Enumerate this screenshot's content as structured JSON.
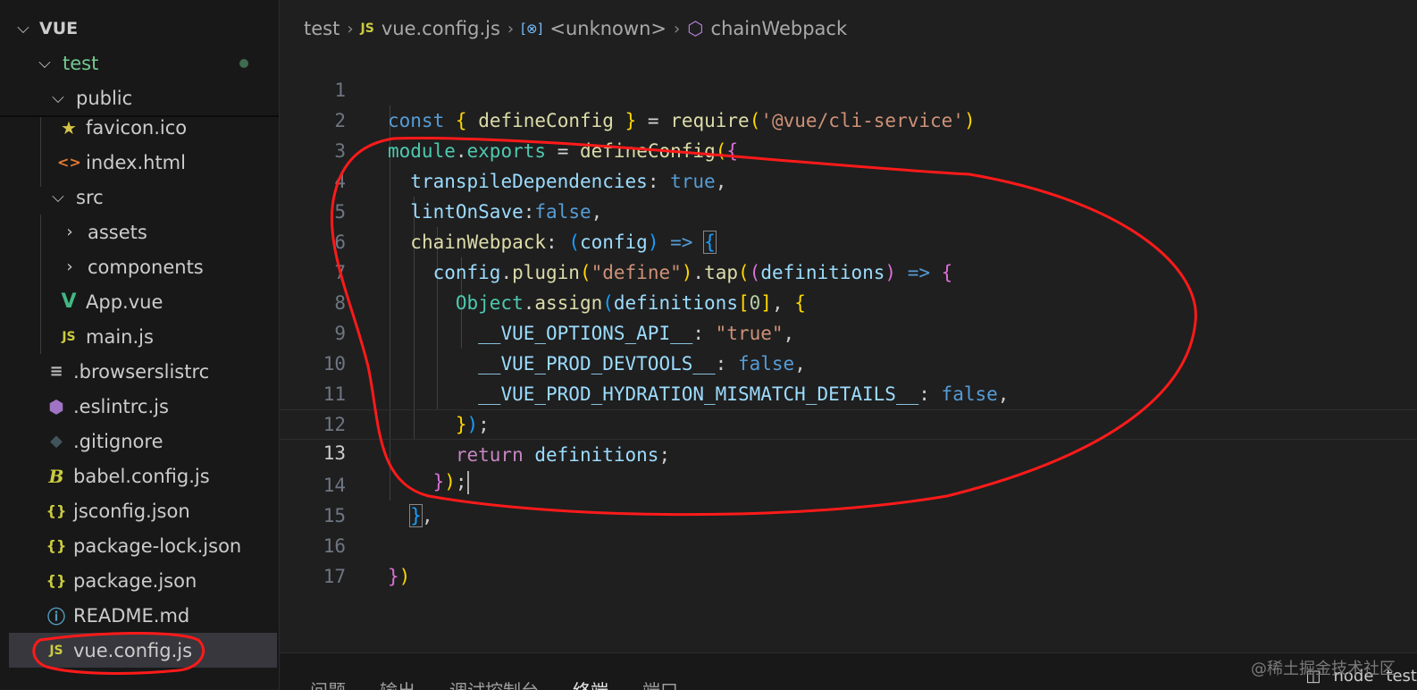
{
  "explorer": {
    "root_label": "VUE",
    "items": [
      {
        "label": "test",
        "icon": "chevron-down-icon",
        "color": "#73c991"
      },
      {
        "label": "public",
        "icon": "chevron-down-icon"
      },
      {
        "label": "favicon.ico",
        "icon": "star-icon"
      },
      {
        "label": "index.html",
        "icon": "html-icon"
      },
      {
        "label": "src",
        "icon": "chevron-down-icon"
      },
      {
        "label": "assets",
        "icon": "chevron-right-icon"
      },
      {
        "label": "components",
        "icon": "chevron-right-icon"
      },
      {
        "label": "App.vue",
        "icon": "vue-icon"
      },
      {
        "label": "main.js",
        "icon": "js-icon"
      },
      {
        "label": ".browserslistrc",
        "icon": "list-icon"
      },
      {
        "label": ".eslintrc.js",
        "icon": "eslint-icon"
      },
      {
        "label": ".gitignore",
        "icon": "git-icon"
      },
      {
        "label": "babel.config.js",
        "icon": "babel-icon"
      },
      {
        "label": "jsconfig.json",
        "icon": "json-icon"
      },
      {
        "label": "package-lock.json",
        "icon": "json-icon"
      },
      {
        "label": "package.json",
        "icon": "json-icon"
      },
      {
        "label": "README.md",
        "icon": "info-icon"
      },
      {
        "label": "vue.config.js",
        "icon": "js-icon",
        "selected": true
      }
    ]
  },
  "breadcrumb": {
    "folder": "test",
    "file": "vue.config.js",
    "scope": "<unknown>",
    "symbol": "chainWebpack"
  },
  "icons": {
    "js_glyph": "JS",
    "json_glyph": "{}",
    "html_glyph": "<>",
    "scope_glyph": "[⊗]",
    "symbol_glyph": "⬡"
  },
  "editor": {
    "current_line": 13,
    "lines": [
      {
        "n": "1",
        "text": "const { defineConfig } = require('@vue/cli-service')"
      },
      {
        "n": "2",
        "text": "module.exports = defineConfig({"
      },
      {
        "n": "3",
        "text": "  transpileDependencies: true,"
      },
      {
        "n": "4",
        "text": "  lintOnSave:false,"
      },
      {
        "n": "5",
        "text": "  chainWebpack: (config) => {"
      },
      {
        "n": "6",
        "text": "    config.plugin(\"define\").tap((definitions) => {"
      },
      {
        "n": "7",
        "text": "      Object.assign(definitions[0], {"
      },
      {
        "n": "8",
        "text": "        __VUE_OPTIONS_API__: \"true\","
      },
      {
        "n": "9",
        "text": "        __VUE_PROD_DEVTOOLS__: false,"
      },
      {
        "n": "10",
        "text": "        __VUE_PROD_HYDRATION_MISMATCH_DETAILS__: false,"
      },
      {
        "n": "11",
        "text": "      });"
      },
      {
        "n": "12",
        "text": "      return definitions;"
      },
      {
        "n": "13",
        "text": "    });"
      },
      {
        "n": "14",
        "text": "  },"
      },
      {
        "n": "15",
        "text": ""
      },
      {
        "n": "16",
        "text": "})"
      },
      {
        "n": "17",
        "text": ""
      }
    ]
  },
  "panel": {
    "tabs": [
      "问题",
      "输出",
      "调试控制台",
      "终端",
      "端口"
    ],
    "active_tab": "终端"
  },
  "status_tail": {
    "items": [
      "node",
      "test"
    ]
  },
  "watermark": "@稀土掘金技术社区",
  "annotation_color": "#ff1a1a"
}
